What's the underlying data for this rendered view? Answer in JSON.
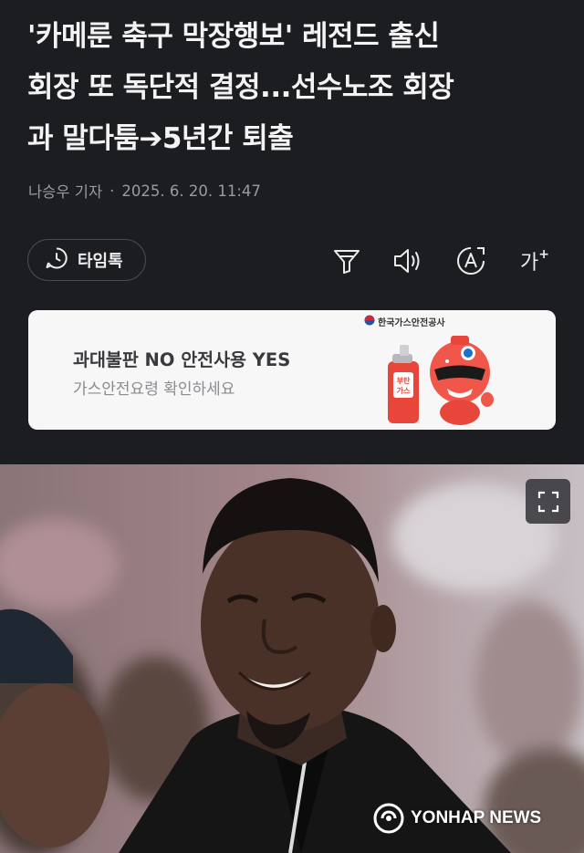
{
  "article": {
    "headline": "'카메룬 축구 막장행보' 레전드 출신\n회장 또 독단적 결정...선수노조 회장\n과 말다툼➔5년간 퇴출",
    "reporter": "나승우 기자",
    "separator": "·",
    "date": "2025. 6. 20. 11:47"
  },
  "toolbar": {
    "timetalk_label": "타임톡",
    "icons": [
      "filter-icon",
      "speaker-icon",
      "translate-icon",
      "font-size-icon"
    ],
    "font_size_glyph": "가"
  },
  "ad": {
    "title": "과대불판 NO 안전사용 YES",
    "subtitle": "가스안전요령 확인하세요",
    "brand": "한국가스안전공사",
    "can_label": "부탄 가스"
  },
  "photo": {
    "watermark": "YONHAP NEWS"
  },
  "colors": {
    "background": "#1c1d21",
    "ad_background": "#f7f7f8",
    "mascot_red": "#e8463a"
  }
}
